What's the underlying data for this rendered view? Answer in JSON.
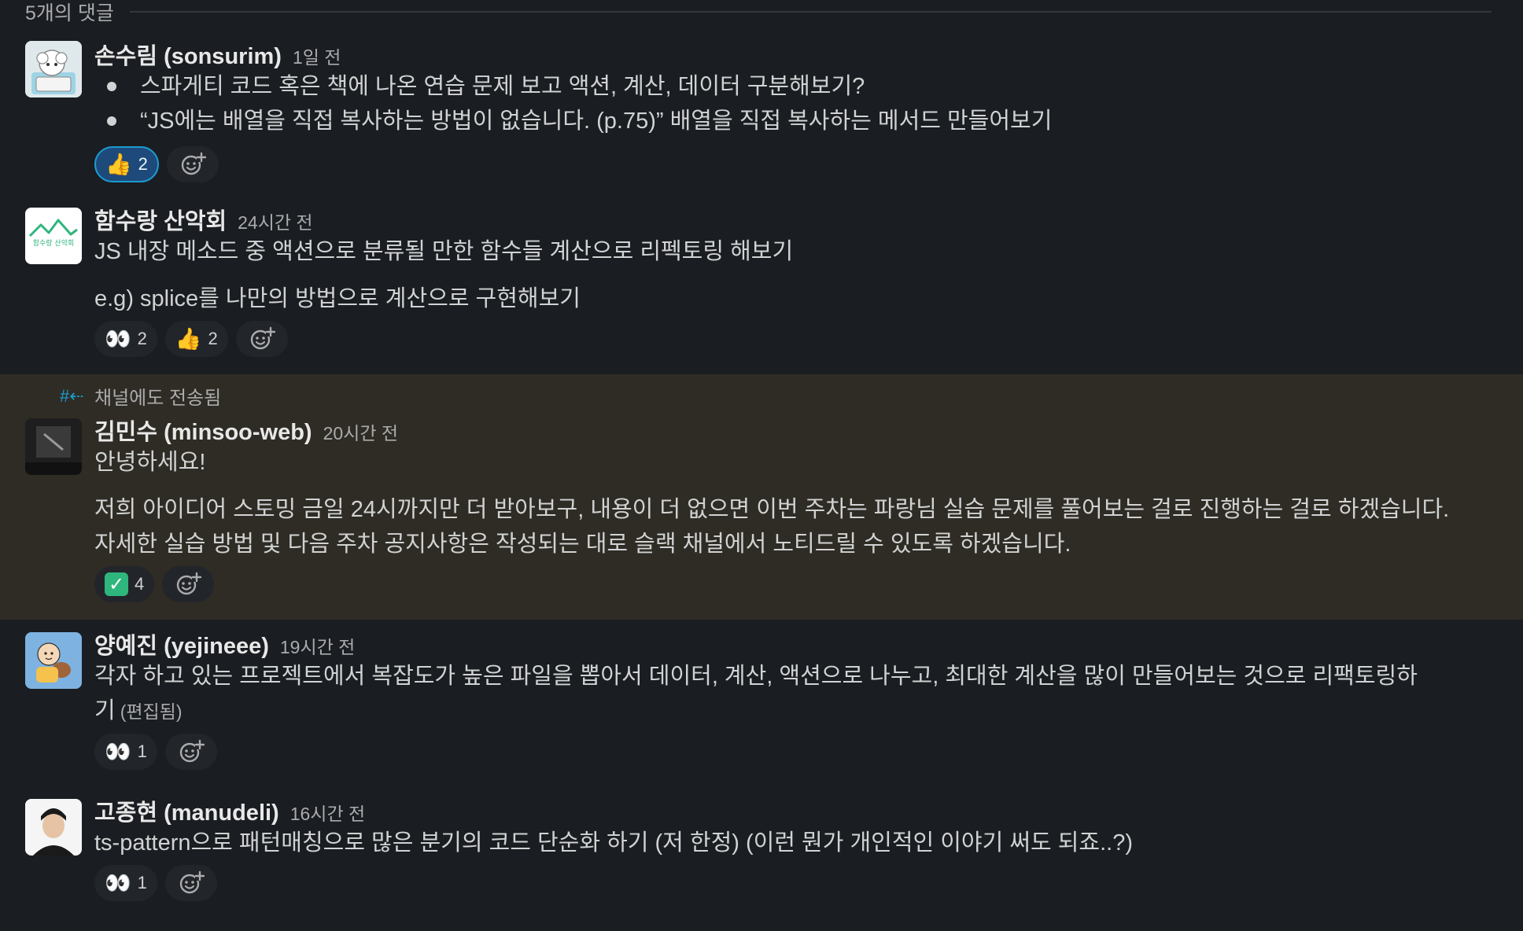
{
  "thread": {
    "reply_count_label": "5개의 댓글"
  },
  "messages": [
    {
      "author": "손수림 (sonsurim)",
      "time": "1일 전",
      "bullets": [
        "스파게티 코드 혹은 책에 나온 연습 문제 보고 액션, 계산, 데이터 구분해보기?",
        "“JS에는 배열을 직접 복사하는 방법이 없습니다. (p.75)” 배열을 직접 복사하는 메서드 만들어보기"
      ],
      "reactions": [
        {
          "emoji": "👍",
          "icon": "thumbs-up-emoji",
          "count": "2",
          "active": true
        }
      ]
    },
    {
      "author": "함수랑 산악회",
      "time": "24시간 전",
      "lines": [
        "JS 내장 메소드 중 액션으로 분류될 만한 함수들 계산으로 리펙토링 해보기",
        "e.g) splice를 나만의 방법으로 계산으로 구현해보기"
      ],
      "avatar_text": "함수랑 산악회",
      "reactions": [
        {
          "emoji": "👀",
          "icon": "eyes-emoji",
          "count": "2"
        },
        {
          "emoji": "👍",
          "icon": "thumbs-up-emoji",
          "count": "2"
        }
      ]
    },
    {
      "shared_note": "채널에도 전송됨",
      "author": "김민수 (minsoo-web)",
      "time": "20시간 전",
      "lines": [
        "안녕하세요!",
        "저희 아이디어 스토밍 금일 24시까지만 더 받아보구, 내용이 더 없으면 이번 주차는 파랑님 실습 문제를 풀어보는 걸로 진행하는 걸로 하겠습니다.",
        "자세한 실습 방법 및 다음 주차 공지사항은 작성되는 대로 슬랙 채널에서 노티드릴 수 있도록 하겠습니다."
      ],
      "reactions": [
        {
          "emoji": "✓",
          "icon": "check-mark-emoji",
          "count": "4"
        }
      ]
    },
    {
      "author": "양예진 (yejineee)",
      "time": "19시간 전",
      "lines": [
        "각자 하고 있는 프로젝트에서 복잡도가 높은 파일을 뽑아서 데이터, 계산, 액션으로 나누고, 최대한 계산을 많이 만들어보는 것으로 리팩토링하",
        "기"
      ],
      "edited": "(편집됨)",
      "reactions": [
        {
          "emoji": "👀",
          "icon": "eyes-emoji",
          "count": "1"
        }
      ]
    },
    {
      "author": "고종현 (manudeli)",
      "time": "16시간 전",
      "lines": [
        "ts-pattern으로 패턴매칭으로 많은 분기의 코드 단순화 하기 (저 한정) (이런 뭔가 개인적인 이야기 써도 되죠..?)"
      ],
      "reactions": [
        {
          "emoji": "👀",
          "icon": "eyes-emoji",
          "count": "1"
        }
      ]
    }
  ]
}
